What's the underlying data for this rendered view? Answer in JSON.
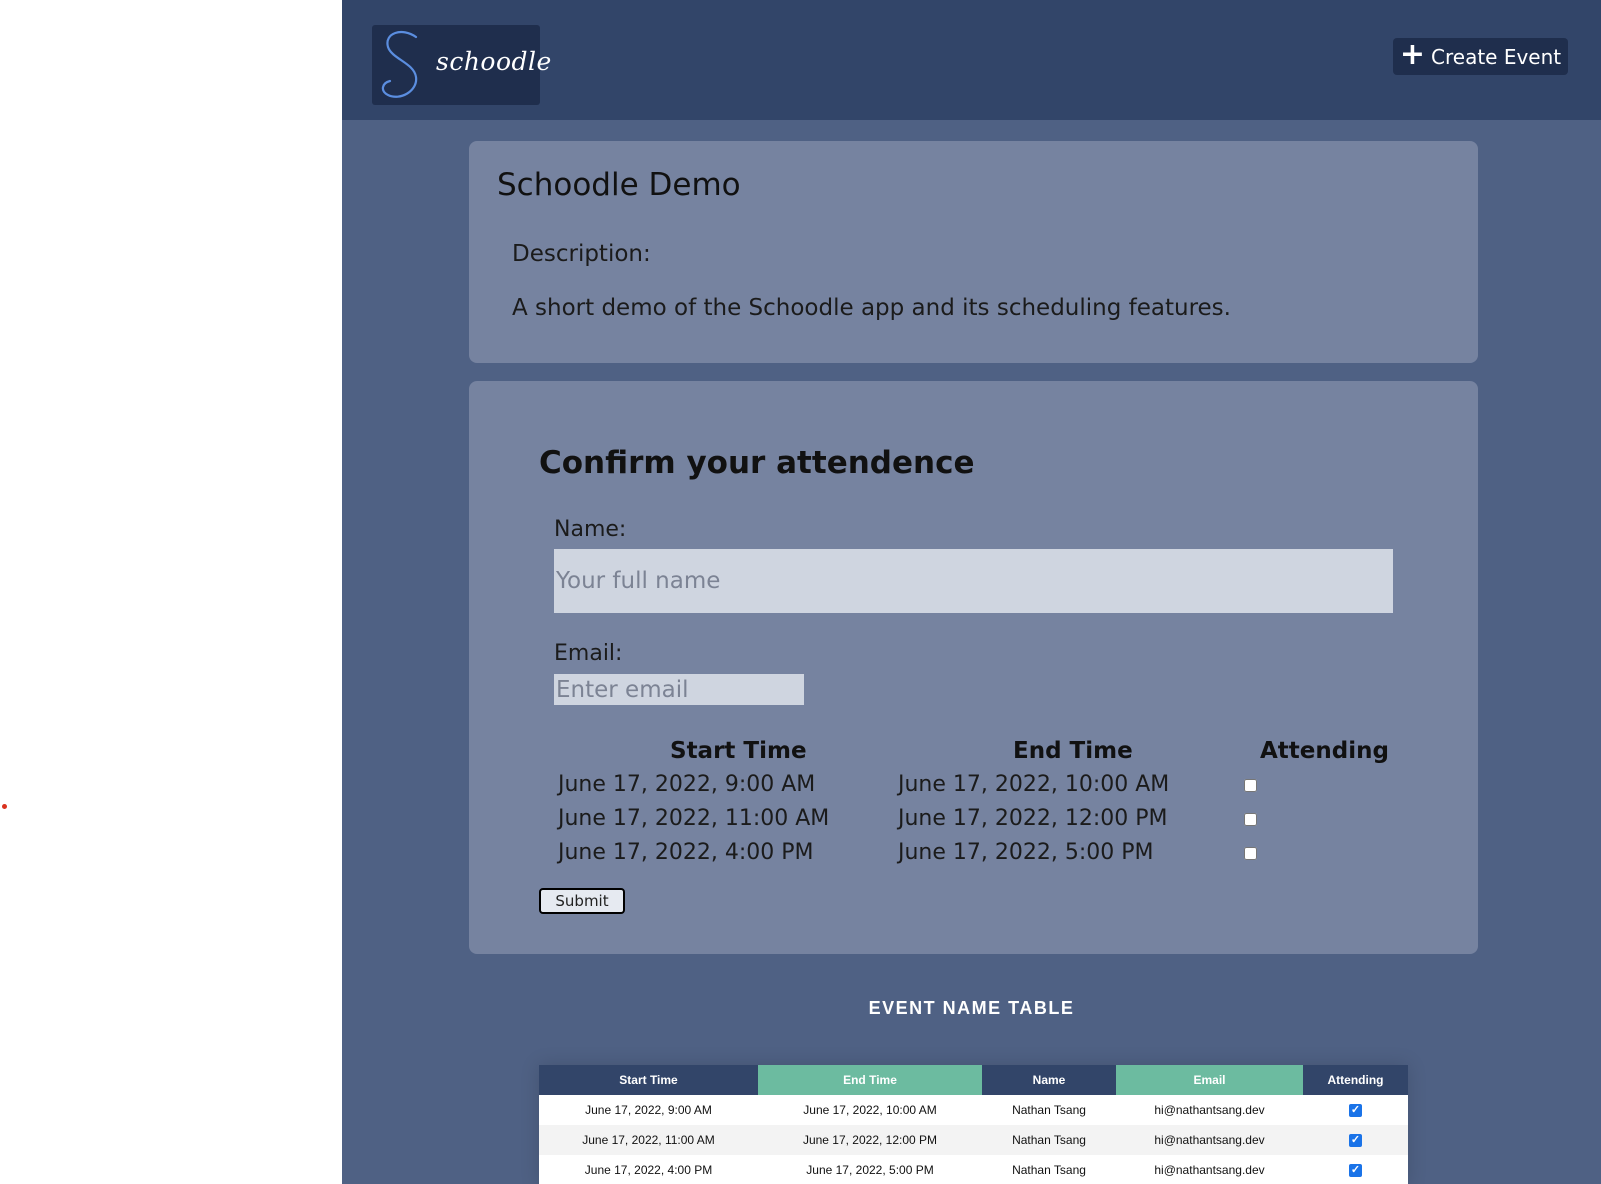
{
  "header": {
    "logo_text": "schoodle",
    "create_button_label": "Create Event"
  },
  "event": {
    "title": "Schoodle Demo",
    "description_label": "Description:",
    "description": "A short demo of the Schoodle app and its scheduling features."
  },
  "form": {
    "title": "Confirm your attendence",
    "name_label": "Name:",
    "name_placeholder": "Your full name",
    "email_label": "Email:",
    "email_placeholder": "Enter email",
    "slot_headers": [
      "Start Time",
      "End Time",
      "Attending"
    ],
    "slots": [
      {
        "start": "June 17, 2022, 9:00 AM",
        "end": "June 17, 2022, 10:00 AM",
        "attending": false
      },
      {
        "start": "June 17, 2022, 11:00 AM",
        "end": "June 17, 2022, 12:00 PM",
        "attending": false
      },
      {
        "start": "June 17, 2022, 4:00 PM",
        "end": "June 17, 2022, 5:00 PM",
        "attending": false
      }
    ],
    "submit_label": "Submit"
  },
  "table": {
    "heading": "EVENT NAME TABLE",
    "columns": [
      "Start Time",
      "End Time",
      "Name",
      "Email",
      "Attending"
    ],
    "rows": [
      {
        "start": "June 17, 2022, 9:00 AM",
        "end": "June 17, 2022, 10:00 AM",
        "name": "Nathan Tsang",
        "email": "hi@nathantsang.dev",
        "attending": true
      },
      {
        "start": "June 17, 2022, 11:00 AM",
        "end": "June 17, 2022, 12:00 PM",
        "name": "Nathan Tsang",
        "email": "hi@nathantsang.dev",
        "attending": true
      },
      {
        "start": "June 17, 2022, 4:00 PM",
        "end": "June 17, 2022, 5:00 PM",
        "name": "Nathan Tsang",
        "email": "hi@nathantsang.dev",
        "attending": true
      }
    ]
  },
  "colors": {
    "page_bg": "#4f6184",
    "topbar_bg": "#324569",
    "card_bg": "#7683a0",
    "accent_green": "#6cbba0",
    "checkbox_blue": "#1a73e8"
  },
  "icons": {
    "logo": "script-s-logo-icon",
    "create": "plus-icon",
    "attending": "checkmark-icon"
  }
}
